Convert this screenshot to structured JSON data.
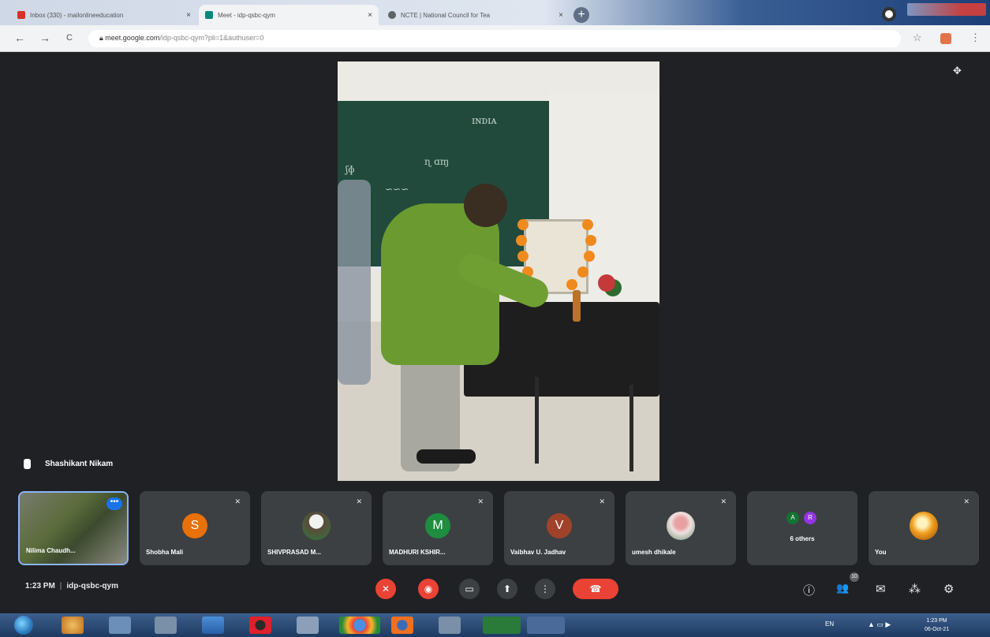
{
  "browser": {
    "tabs": [
      {
        "title": "Inbox (330) - mailonlineeducation",
        "favicon_color": "#d93025"
      },
      {
        "title": "Meet - idp-qsbc-qym",
        "favicon_color": "#00897b"
      },
      {
        "title": "NCTE | National Council for Tea",
        "favicon_color": "#5f6368"
      }
    ],
    "new_tab": "+",
    "url_host": "meet.google.com",
    "url_path": "/idp-qsbc-qym?pli=1&authuser=0",
    "back": "←",
    "forward": "→",
    "reload": "C",
    "star": "☆",
    "menu": "⋮"
  },
  "meet": {
    "main_speaker": "Shashikant Nikam",
    "pin_icon": "✥",
    "participants": [
      {
        "name": "Nilima Chaudh...",
        "type": "video"
      },
      {
        "name": "Shobha Mali",
        "initial": "S",
        "color": "#e8710a"
      },
      {
        "name": "SHIVPRASAD M...",
        "type": "photo"
      },
      {
        "name": "MADHURI KSHIR...",
        "initial": "M",
        "color": "#1e8e3e"
      },
      {
        "name": "Vaibhav U. Jadhav",
        "initial": "V",
        "color": "#a0422a"
      },
      {
        "name": "umesh dhikale",
        "type": "photo"
      },
      {
        "name": "6 others",
        "type": "others",
        "initials": [
          "A",
          "R"
        ],
        "colors": [
          "#137333",
          "#9334e6"
        ]
      },
      {
        "name": "You",
        "type": "photo"
      }
    ],
    "time": "1:23 PM",
    "meeting_code": "idp-qsbc-qym",
    "controls": {
      "mic": "✕",
      "camera": "◉",
      "captions": "▭",
      "present": "⬆",
      "more": "⋮",
      "leave": "☎"
    },
    "right_controls": {
      "info": "ⓘ",
      "people": "👥",
      "people_count": "10",
      "chat": "✉",
      "activities": "⁂",
      "host": "⚙"
    }
  },
  "taskbar": {
    "lang": "EN",
    "tray": "▲ ▭ ▶",
    "time": "1:23 PM",
    "date": "06-Oct-21"
  }
}
